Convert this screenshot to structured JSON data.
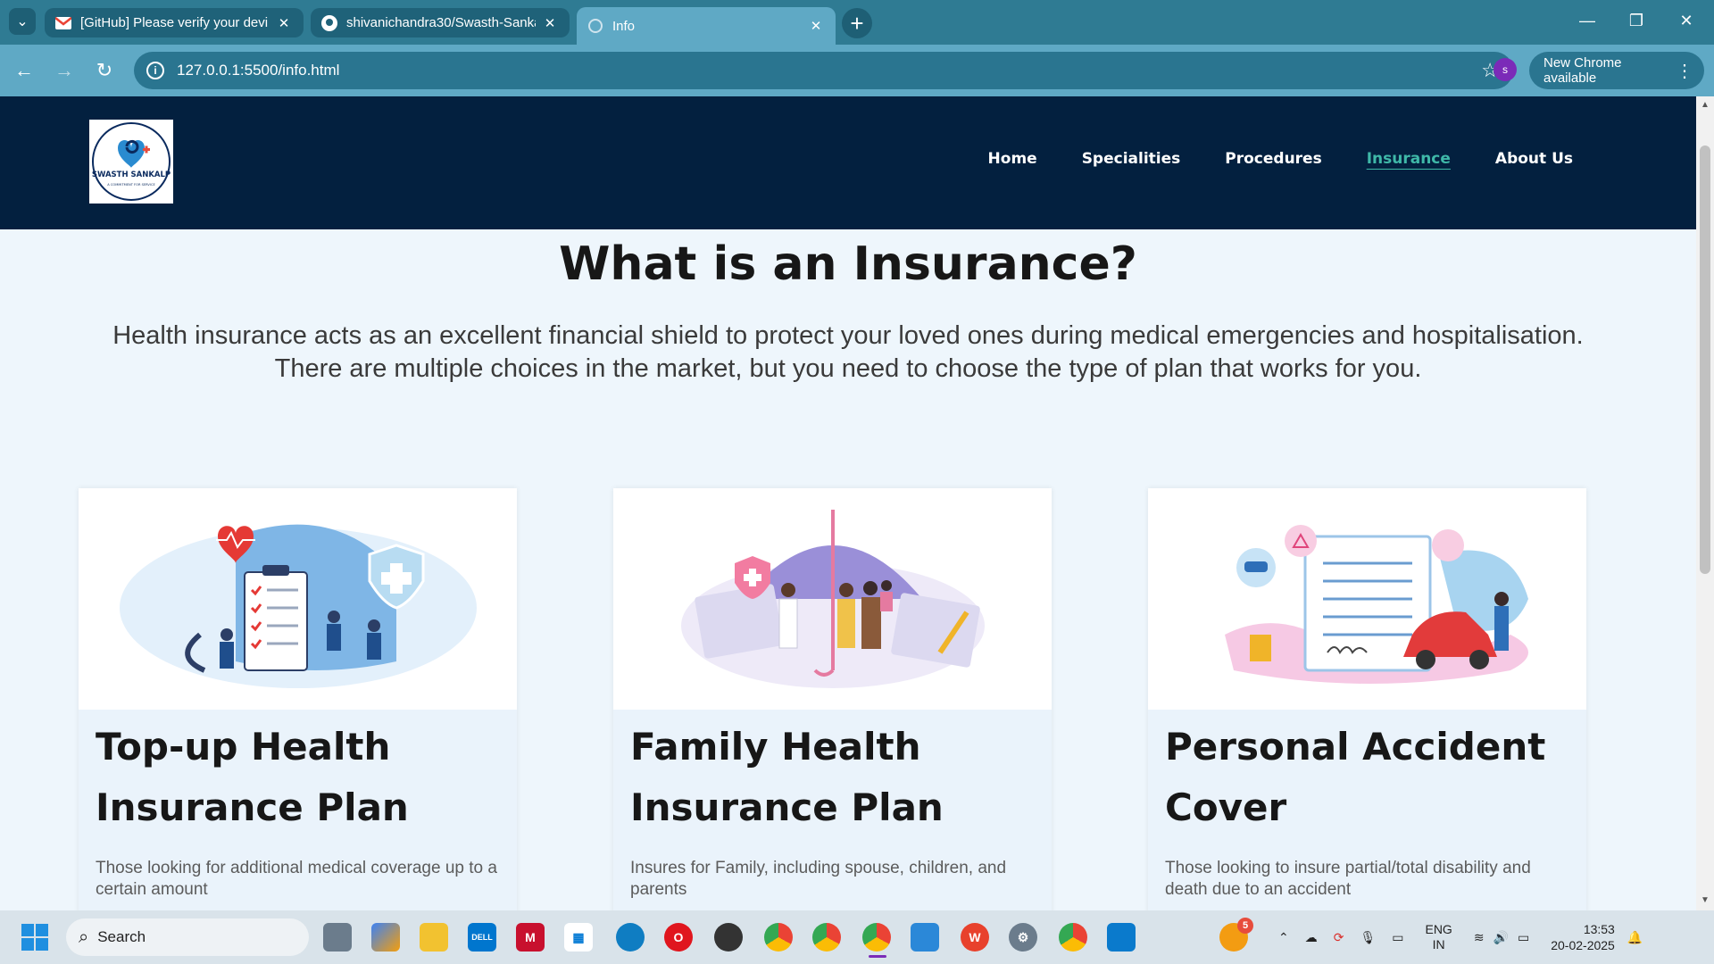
{
  "browser": {
    "tabs": [
      {
        "title": "[GitHub] Please verify your devi",
        "favicon": "gmail-icon",
        "active": false
      },
      {
        "title": "shivanichandra30/Swasth-Sanka",
        "favicon": "github-icon",
        "active": false
      },
      {
        "title": "Info",
        "favicon": "globe-icon",
        "active": true
      }
    ],
    "url": "127.0.0.1:5500/info.html",
    "profile_initial": "s",
    "update_label": "New Chrome available"
  },
  "site": {
    "logo_text": "SWASTH SANKALP",
    "logo_tagline": "A COMMITMENT FOR SERVICE",
    "nav": [
      {
        "label": "Home",
        "active": false
      },
      {
        "label": "Specialities",
        "active": false
      },
      {
        "label": "Procedures",
        "active": false
      },
      {
        "label": "Insurance",
        "active": true
      },
      {
        "label": "About Us",
        "active": false
      }
    ],
    "hero_title": "What is an Insurance?",
    "hero_text": "Health insurance acts as an excellent financial shield to protect your loved ones during medical emergencies and hospitalisation. There are multiple choices in the market, but you need to choose the type of plan that works for you.",
    "cards": [
      {
        "title": "Top-up Health Insurance Plan",
        "desc": "Those looking for additional medical coverage up to a certain amount"
      },
      {
        "title": "Family Health Insurance Plan",
        "desc": "Insures for Family, including spouse, children, and parents"
      },
      {
        "title": "Personal Accident Cover",
        "desc": "Those looking to insure partial/total disability and death due to an accident"
      }
    ]
  },
  "taskbar": {
    "search_label": "Search",
    "notification_count": "5",
    "lang_line1": "ENG",
    "lang_line2": "IN",
    "time": "13:53",
    "date": "20-02-2025"
  },
  "colors": {
    "header_bg": "#03203f",
    "nav_active": "#3fb8a8",
    "tab_strip": "#2f7b93"
  }
}
